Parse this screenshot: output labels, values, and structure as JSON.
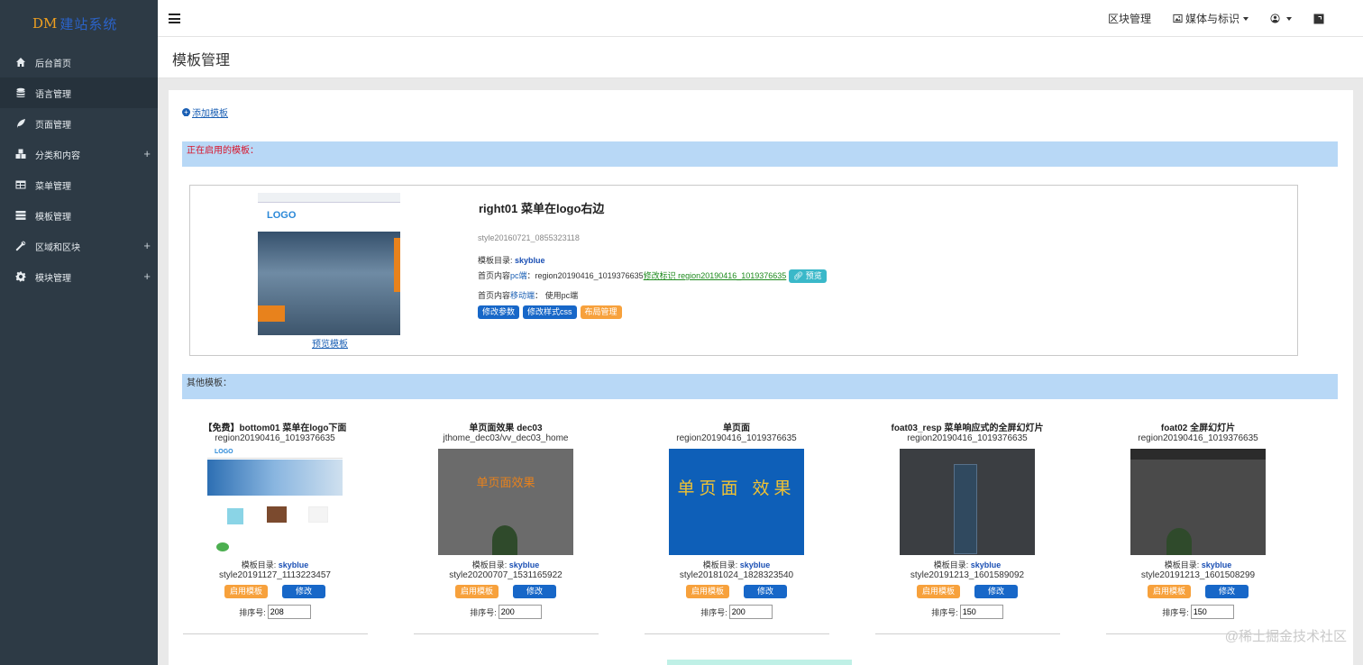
{
  "brand": {
    "dm": "DM",
    "rest": "建站系统"
  },
  "sidebar": {
    "items": [
      {
        "label": "后台首页",
        "icon": "home-icon"
      },
      {
        "label": "语言管理",
        "icon": "database-icon",
        "active": true
      },
      {
        "label": "页面管理",
        "icon": "leaf-icon"
      },
      {
        "label": "分类和内容",
        "icon": "cubes-icon",
        "expandable": "+"
      },
      {
        "label": "菜单管理",
        "icon": "table-icon"
      },
      {
        "label": "模板管理",
        "icon": "list-icon"
      },
      {
        "label": "区域和区块",
        "icon": "wrench-icon",
        "expandable": "+"
      },
      {
        "label": "模块管理",
        "icon": "gear-icon",
        "expandable": "+"
      }
    ]
  },
  "topbar": {
    "block_manage": "区块管理",
    "media": "媒体与标识"
  },
  "page": {
    "title": "模板管理"
  },
  "panel": {
    "add_template": "添加模板",
    "current_bar": "正在启用的模板：",
    "others_bar": "其他模板："
  },
  "current": {
    "title": "right01 菜单在logo右边",
    "style_id": "style20160721_0855323118",
    "dir_label": "模板目录: ",
    "dir_value": "skyblue",
    "pc_prefix": "首页内容",
    "pc_word": "pc端",
    "pc_colon": "：",
    "pc_region": "region20190416_1019376635",
    "pc_modify": "修改标识 region20190416_1019376635",
    "preview_btn": "预览",
    "mobile_prefix": "首页内容",
    "mobile_word": "移动端",
    "mobile_colon": "：",
    "mobile_value": "使用pc端",
    "btn_params": "修改参数",
    "btn_css": "修改样式css",
    "btn_layout": "布局管理",
    "preview_link": "预览模板",
    "thumb_logo": "LOGO"
  },
  "templates": [
    {
      "name": "【免费】bottom01 菜单在logo下面",
      "region": "region20190416_1019376635",
      "dir_label": "模板目录: ",
      "dir": "skyblue",
      "style": "style20191127_1113223457",
      "enable": "启用模板",
      "modify": "修改",
      "sort_label": "排序号:",
      "sort": "208",
      "thumb_logo": "LOGO"
    },
    {
      "name": "单页面效果 dec03",
      "region": "jthome_dec03/vv_dec03_home",
      "dir_label": "模板目录: ",
      "dir": "skyblue",
      "style": "style20200707_1531165922",
      "enable": "启用模板",
      "modify": "修改",
      "sort_label": "排序号:",
      "sort": "200",
      "thumb_text": "单页面效果"
    },
    {
      "name": "单页面",
      "region": "region20190416_1019376635",
      "dir_label": "模板目录: ",
      "dir": "skyblue",
      "style": "style20181024_1828323540",
      "enable": "启用模板",
      "modify": "修改",
      "sort_label": "排序号:",
      "sort": "200",
      "thumb_text": "单页面 效果"
    },
    {
      "name": "foat03_resp 菜单响应式的全屏幻灯片",
      "region": "region20190416_1019376635",
      "dir_label": "模板目录: ",
      "dir": "skyblue",
      "style": "style20191213_1601589092",
      "enable": "启用模板",
      "modify": "修改",
      "sort_label": "排序号:",
      "sort": "150"
    },
    {
      "name": "foat02 全屏幻灯片",
      "region": "region20190416_1019376635",
      "dir_label": "模板目录: ",
      "dir": "skyblue",
      "style": "style20191213_1601508299",
      "enable": "启用模板",
      "modify": "修改",
      "sort_label": "排序号:",
      "sort": "150"
    }
  ],
  "watermark": "@稀土掘金技术社区",
  "colors": {
    "sidebar_bg": "#2d3a45",
    "accent_blue": "#1767c8",
    "accent_orange": "#f7a13c",
    "teal": "#3ab8c9",
    "bar_blue": "#b8d8f6"
  }
}
